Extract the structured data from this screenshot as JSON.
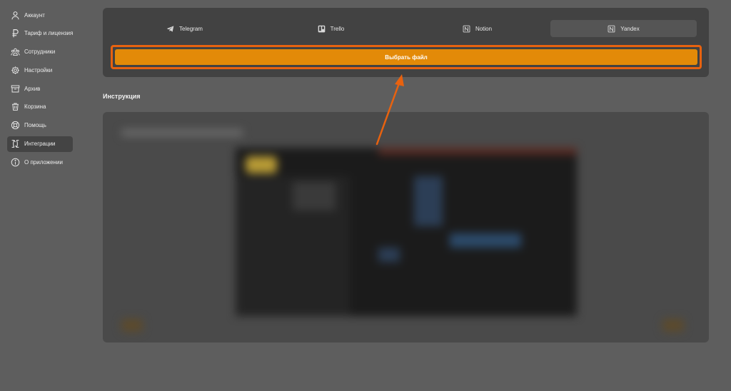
{
  "sidebar": {
    "items": [
      {
        "label": "Аккаунт",
        "icon": "user-icon"
      },
      {
        "label": "Тариф и лицензия",
        "icon": "ruble-icon"
      },
      {
        "label": "Сотрудники",
        "icon": "team-icon"
      },
      {
        "label": "Настройки",
        "icon": "gear-icon"
      },
      {
        "label": "Архив",
        "icon": "archive-icon"
      },
      {
        "label": "Корзина",
        "icon": "trash-icon"
      },
      {
        "label": "Помощь",
        "icon": "lifebuoy-icon"
      },
      {
        "label": "Интеграции",
        "icon": "integrations-icon",
        "active": true
      },
      {
        "label": "О приложении",
        "icon": "info-icon"
      }
    ]
  },
  "tabs": [
    {
      "label": "Telegram",
      "icon": "telegram-icon"
    },
    {
      "label": "Trello",
      "icon": "trello-icon"
    },
    {
      "label": "Notion",
      "icon": "notion-icon"
    },
    {
      "label": "Yandex",
      "icon": "notion-icon",
      "active": true
    }
  ],
  "upload": {
    "button_label": "Выбрать файл"
  },
  "instruction": {
    "title": "Инструкция"
  },
  "colors": {
    "accent": "#e38a08",
    "highlight": "#e8620f",
    "background": "#5e5e5e",
    "panel": "#424242"
  }
}
